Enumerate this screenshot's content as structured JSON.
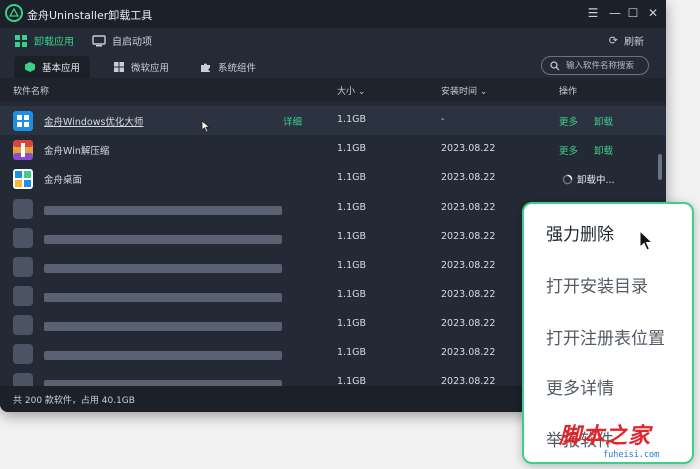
{
  "window": {
    "title": "金舟Uninstaller卸载工具"
  },
  "window_controls": [
    "☰",
    "—",
    "☐",
    "✕"
  ],
  "topbar": {
    "uninstall_label": "卸载应用",
    "startup_label": "自启动项",
    "refresh_label": "刷新"
  },
  "tabs": [
    {
      "label": "基本应用",
      "active": true
    },
    {
      "label": "微软应用",
      "active": false
    },
    {
      "label": "系统组件",
      "active": false
    }
  ],
  "search": {
    "placeholder": "输入软件名称搜索"
  },
  "columns": {
    "name": "软件名称",
    "size": "大小",
    "install_time": "安装时间",
    "actions": "操作"
  },
  "rows": [
    {
      "name": "金舟Windows优化大师",
      "detail": "详细",
      "size": "1.1GB",
      "date": "-",
      "more": "更多",
      "uninstall": "卸载"
    },
    {
      "name": "金舟Win解压缩",
      "size": "1.1GB",
      "date": "2023.08.22",
      "more": "更多",
      "uninstall": "卸载"
    },
    {
      "name": "金舟桌面",
      "size": "1.1GB",
      "date": "2023.08.22",
      "status": "卸载中..."
    },
    {
      "size": "1.1GB",
      "date": "2023.08.22"
    },
    {
      "size": "1.1GB",
      "date": "2023.08.22"
    },
    {
      "size": "1.1GB",
      "date": "2023.08.22"
    },
    {
      "size": "1.1GB",
      "date": "2023.08.22"
    },
    {
      "size": "1.1GB",
      "date": "2023.08.22"
    },
    {
      "size": "1.1GB",
      "date": "2023.08.22"
    },
    {
      "size": "1.1GB",
      "date": "2023.08.22"
    }
  ],
  "footer": {
    "summary": "共 200 款软件，占用 40.1GB"
  },
  "context_menu": {
    "items": [
      "强力删除",
      "打开安装目录",
      "打开注册表位置",
      "更多详情",
      "举报软件"
    ]
  },
  "watermark": {
    "text": "脚本之家",
    "url": "fuheisi.com"
  },
  "colors": {
    "accent": "#3ad08b",
    "background": "#242a35",
    "menu_border": "#3ad08b"
  }
}
